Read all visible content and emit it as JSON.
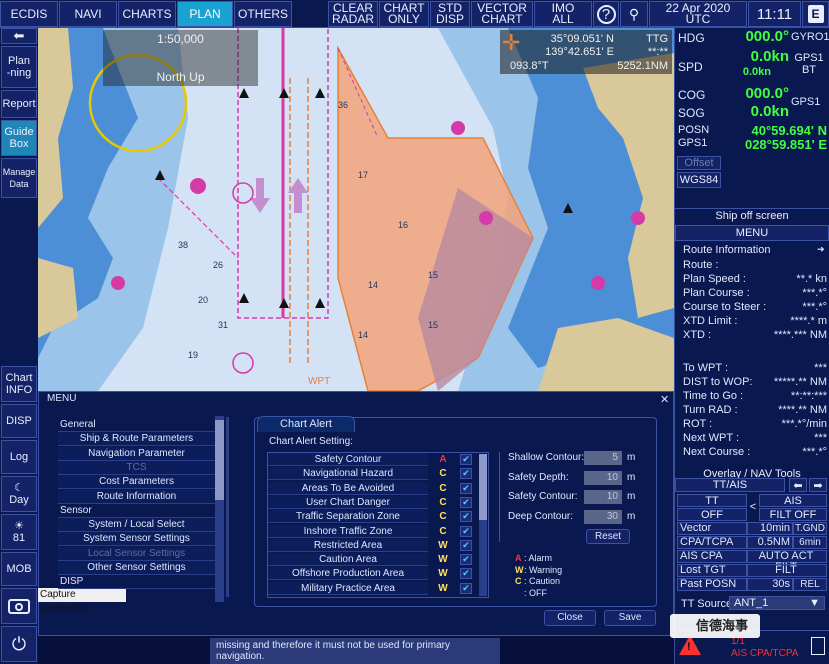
{
  "topbar": {
    "ecdis": "ECDIS",
    "navi": "NAVI",
    "charts": "CHARTS",
    "plan": "PLAN",
    "others": "OTHERS",
    "clear_radar": [
      "CLEAR",
      "RADAR"
    ],
    "chart_only": [
      "CHART",
      "ONLY"
    ],
    "std_disp": [
      "STD",
      "DISP"
    ],
    "vector_chart": [
      "VECTOR",
      "CHART"
    ],
    "imo_all": [
      "IMO",
      "ALL"
    ],
    "date": "22 Apr 2020",
    "tz": "UTC",
    "time": "11:11"
  },
  "leftcol": {
    "planning": [
      "Plan",
      "-ning"
    ],
    "report": "Report",
    "guidebox": [
      "Guide",
      "Box"
    ],
    "manage_data": [
      "Manage",
      "Data"
    ],
    "chart_info": [
      "Chart",
      "INFO"
    ],
    "disp": "DISP",
    "log": "Log",
    "day": "Day",
    "brightness": "81",
    "mob": "MOB"
  },
  "chart": {
    "scale": "1:50,000",
    "orientation": "North Up",
    "cursor_lat": "35°09.051' N",
    "cursor_lon": "139°42.651' E",
    "ttg": "TTG",
    "ttg_val": "**:**",
    "brg": "093.8°T",
    "dist": "5252.1NM",
    "wpt": "WPT"
  },
  "right": {
    "hdg_label": "HDG",
    "hdg": "000.0°",
    "hdg_src": "GYRO1",
    "spd_label": "SPD",
    "spd": "0.0kn",
    "spd2": "0.0kn",
    "spd_src": [
      "GPS1",
      "BT"
    ],
    "cog_label": "COG",
    "cog": "000.0°",
    "sog_label": "SOG",
    "sog": "0.0kn",
    "cog_src": "GPS1",
    "posn_label": [
      "POSN",
      "GPS1"
    ],
    "lat": "40°59.694' N",
    "lon": "028°59.851' E",
    "offset": "Offset",
    "datum": "WGS84",
    "ship_off": "Ship off screen",
    "menu": "MENU",
    "route_info": "Route Information",
    "route": [
      {
        "k": "Route :",
        "v": ""
      },
      {
        "k": "Plan Speed :",
        "v": "**.* kn"
      },
      {
        "k": "Plan Course :",
        "v": "***.*°"
      },
      {
        "k": "Course to Steer :",
        "v": "***.*°"
      },
      {
        "k": "XTD Limit :",
        "v": "****.* m"
      },
      {
        "k": "XTD :",
        "v": "****.*** NM"
      },
      {
        "k": "To WPT :",
        "v": "***"
      },
      {
        "k": "DIST to WOP:",
        "v": "*****.** NM"
      },
      {
        "k": "Time to Go :",
        "v": "**:**:***"
      },
      {
        "k": "Turn RAD :",
        "v": "****.** NM"
      },
      {
        "k": "ROT :",
        "v": "***.*°/min"
      },
      {
        "k": "Next WPT :",
        "v": "***"
      },
      {
        "k": "Next Course :",
        "v": "***.*°"
      }
    ],
    "overlay": "Overlay / NAV Tools",
    "tt_ais": "TT/AIS",
    "tt": "TT",
    "ais": "AIS",
    "tt_off": "OFF",
    "lt": "<",
    "filt_off": "FILT OFF",
    "tt_rows": [
      {
        "k": "Vector",
        "a": "10min",
        "b": "T.GND"
      },
      {
        "k": "CPA/TCPA",
        "a": "0.5NM",
        "b": "6min"
      },
      {
        "k": "AIS CPA",
        "a": "AUTO ACT FILT",
        "b": ""
      },
      {
        "k": "Lost TGT",
        "a": "FILT",
        "b": ""
      },
      {
        "k": "Past POSN",
        "a": "30s",
        "b": "REL"
      }
    ],
    "tt_source": "TT Source:",
    "tt_source_val": "ANT_1",
    "alarm_count": "1/1",
    "alarm_text": "AIS CPA/TCPA"
  },
  "menu": {
    "title": "MENU",
    "capture": "Capture screenshot",
    "items": [
      {
        "t": "General",
        "c": "cat"
      },
      {
        "t": "Ship & Route Parameters",
        "c": ""
      },
      {
        "t": "Navigation Parameter",
        "c": ""
      },
      {
        "t": "TCS",
        "c": "dis"
      },
      {
        "t": "Cost Parameters",
        "c": ""
      },
      {
        "t": "Route Information",
        "c": ""
      },
      {
        "t": "Sensor",
        "c": "cat"
      },
      {
        "t": "System / Local Select",
        "c": ""
      },
      {
        "t": "System Sensor Settings",
        "c": ""
      },
      {
        "t": "Local Sensor Settings",
        "c": "dis"
      },
      {
        "t": "Other Sensor Settings",
        "c": ""
      },
      {
        "t": "DISP",
        "c": "cat"
      }
    ],
    "tab": "Chart Alert",
    "setting": "Chart Alert Setting:",
    "alerts": [
      {
        "n": "Safety Contour",
        "l": "A"
      },
      {
        "n": "Navigational Hazard",
        "l": "C"
      },
      {
        "n": "Areas To Be Avoided",
        "l": "C"
      },
      {
        "n": "User Chart Danger",
        "l": "C"
      },
      {
        "n": "Traffic Separation Zone",
        "l": "C"
      },
      {
        "n": "Inshore Traffic Zone",
        "l": "C"
      },
      {
        "n": "Restricted Area",
        "l": "W"
      },
      {
        "n": "Caution Area",
        "l": "W"
      },
      {
        "n": "Offshore Production Area",
        "l": "W"
      },
      {
        "n": "Military Practice Area",
        "l": "W"
      }
    ],
    "contours": [
      {
        "k": "Shallow Contour:",
        "v": "5",
        "u": "m"
      },
      {
        "k": "Safety Depth:",
        "v": "10",
        "u": "m"
      },
      {
        "k": "Safety Contour:",
        "v": "10",
        "u": "m"
      },
      {
        "k": "Deep Contour:",
        "v": "30",
        "u": "m"
      }
    ],
    "reset": "Reset",
    "legend": [
      {
        "s": "A",
        "t": ": Alarm"
      },
      {
        "s": "W",
        "t": ": Warning"
      },
      {
        "s": "C",
        "t": ": Caution"
      },
      {
        "s": "",
        "t": ": OFF"
      }
    ],
    "close": "Close",
    "save": "Save",
    "bottom_text": "missing and therefore it must not be used for primary",
    "bottom_text2": "navigation."
  },
  "watermark": "信德海事",
  "colors": {
    "accent": "#19a2d2",
    "green": "#3fff3f",
    "alarm": "#ff3030"
  }
}
